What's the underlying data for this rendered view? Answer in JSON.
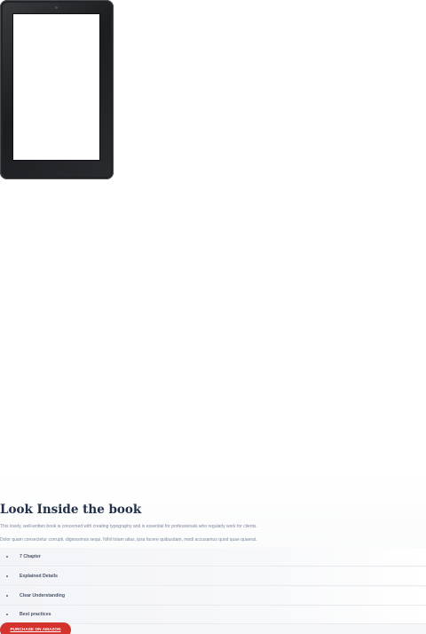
{
  "section": {
    "title": "Look Inside the book",
    "paragraph_1": "This lovely, well-written book is concerned with creating typography and is essential for professionals who regularly work for clients.",
    "paragraph_2": "Dolor quam consectetur corrupti, dignissimos sequi. Nihil totam alias, ipsa facere quibusdam, modi accusamus quod quae quaerat."
  },
  "features": [
    {
      "label": "7 Chapter"
    },
    {
      "label": "Explained Details"
    },
    {
      "label": "Clear Understanding"
    },
    {
      "label": "Best practices"
    }
  ],
  "cta": {
    "label": "PURCHASE ON AMAZON"
  },
  "colors": {
    "heading": "#223048",
    "body_text": "#7d879b",
    "button": "#d4322c",
    "tablet_frame": "#1c1d20"
  }
}
